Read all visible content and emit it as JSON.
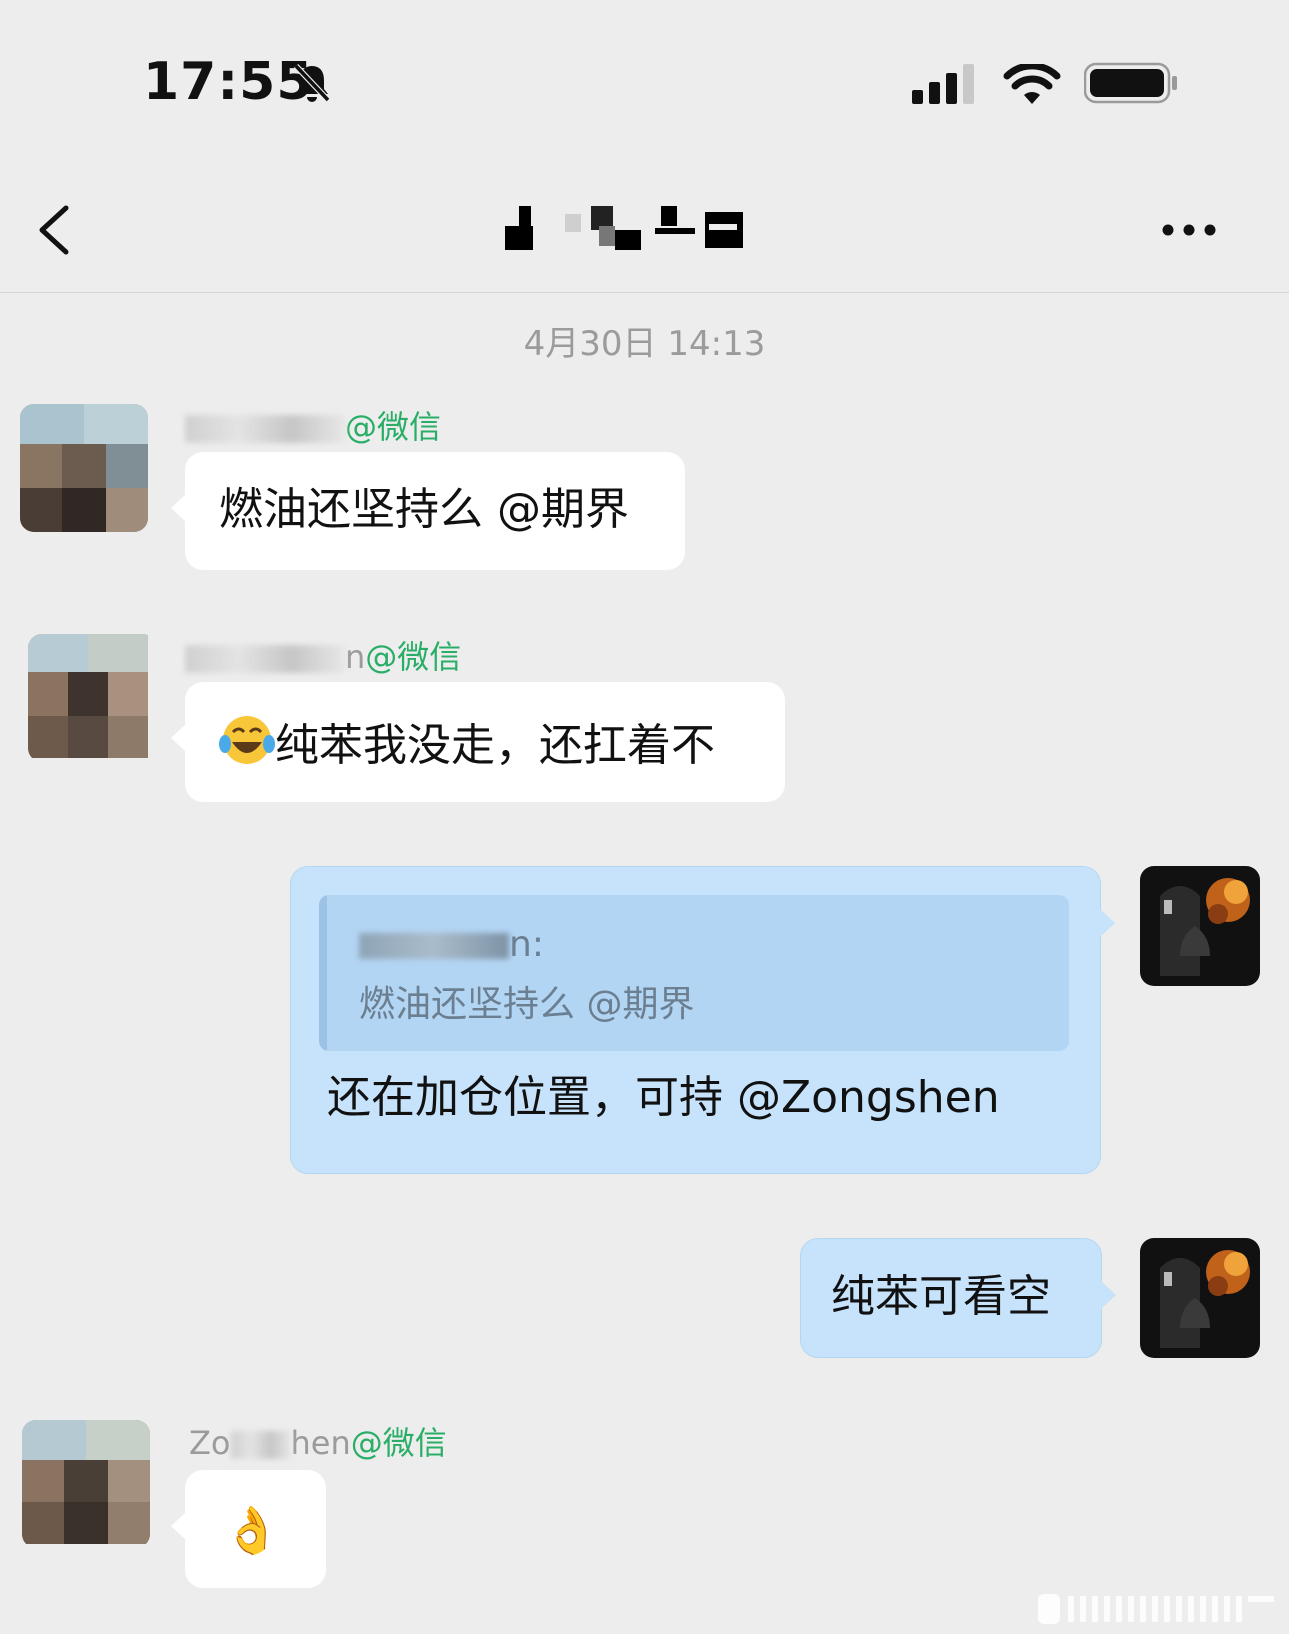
{
  "status_bar": {
    "time": "17:55"
  },
  "chat": {
    "title": ""
  },
  "timestamp": "4月30日 14:13",
  "messages": [
    {
      "sender_name_visible": "",
      "sender_suffix": "@微信",
      "text": "燃油还坚持么 @期界"
    },
    {
      "sender_name_visible": "n",
      "sender_suffix": "@微信",
      "text": "纯苯我没走，还扛着不"
    },
    {
      "quote_name": "n:",
      "quote_text": "燃油还坚持么 @期界",
      "text": "还在加仓位置，可持 @Zongshen"
    },
    {
      "text": "纯苯可看空"
    },
    {
      "sender_name_prefix": "Zo",
      "sender_name_visible": "hen",
      "sender_suffix": "@微信",
      "text": "👌"
    }
  ]
}
